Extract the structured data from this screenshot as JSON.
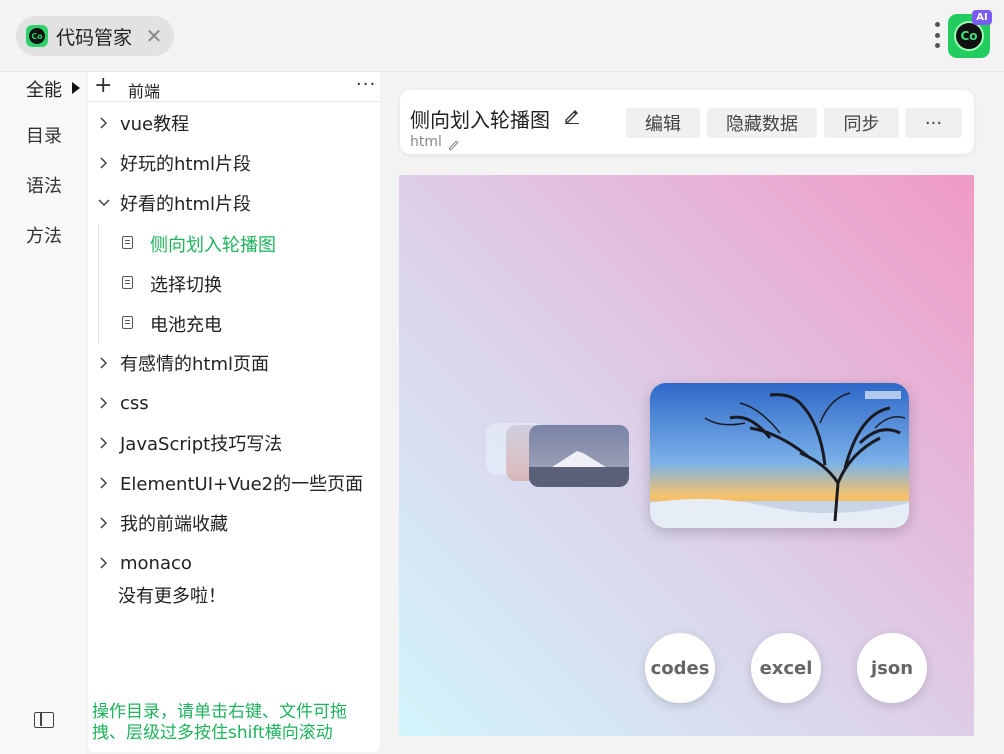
{
  "topbar": {
    "tab_title": "代码管家",
    "close_glyph": "✕",
    "logo_text": "Co",
    "ai_badge": "AI"
  },
  "rail": {
    "active_label": "全能",
    "items": [
      "目录",
      "语法",
      "方法"
    ]
  },
  "tree": {
    "header_add": "+",
    "header_name": "前端",
    "header_more": "···",
    "nodes": [
      {
        "label": "vue教程",
        "expanded": false
      },
      {
        "label": "好玩的html片段",
        "expanded": false
      },
      {
        "label": "好看的html片段",
        "expanded": true
      },
      {
        "label": "有感情的html页面",
        "expanded": false
      },
      {
        "label": "css",
        "expanded": false
      },
      {
        "label": "JavaScript技巧写法",
        "expanded": false
      },
      {
        "label": "ElementUI+Vue2的一些页面",
        "expanded": false
      },
      {
        "label": "我的前端收藏",
        "expanded": false
      },
      {
        "label": "monaco",
        "expanded": false
      }
    ],
    "leaves": [
      "侧向划入轮播图",
      "选择切换",
      "电池充电"
    ],
    "active_leaf": "侧向划入轮播图",
    "end_text": "没有更多啦！",
    "hint": "操作目录，请单击右键、文件可拖拽、层级过多按住shift横向滚动"
  },
  "card": {
    "title": "侧向划入轮播图",
    "subtitle": "html",
    "buttons": [
      "编辑",
      "隐藏数据",
      "同步",
      "···"
    ]
  },
  "preview": {
    "buttons": [
      "codes",
      "excel",
      "json"
    ]
  },
  "colors": {
    "accent_green": "#1fb35c",
    "logo_green": "#22cc5e",
    "ai_purple": "#7a5cf0"
  }
}
